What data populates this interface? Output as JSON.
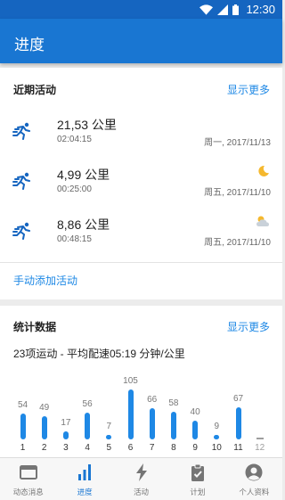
{
  "status_bar": {
    "time": "12:30"
  },
  "app_bar": {
    "title": "进度"
  },
  "recent": {
    "title": "近期活动",
    "more": "显示更多",
    "items": [
      {
        "distance": "21,53 公里",
        "duration": "02:04:15",
        "date": "周一, 2017/11/13",
        "weather": ""
      },
      {
        "distance": "4,99 公里",
        "duration": "00:25:00",
        "date": "周五, 2017/11/10",
        "weather": "moon-icon"
      },
      {
        "distance": "8,86 公里",
        "duration": "00:48:15",
        "date": "周五, 2017/11/10",
        "weather": "cloud-icon"
      }
    ],
    "manual_add": "手动添加活动"
  },
  "stats": {
    "title": "统计数据",
    "more": "显示更多",
    "summary": "23项运动 - 平均配速05:19 分钟/公里"
  },
  "chart_data": {
    "type": "bar",
    "title": "",
    "xlabel": "",
    "ylabel": "",
    "categories": [
      "1",
      "2",
      "3",
      "4",
      "5",
      "6",
      "7",
      "8",
      "9",
      "10",
      "11",
      "12"
    ],
    "values": [
      54,
      49,
      17,
      56,
      7,
      105,
      66,
      58,
      40,
      9,
      67,
      0
    ],
    "value_labels": [
      "54",
      "49",
      "17",
      "56",
      "7",
      "105",
      "66",
      "58",
      "40",
      "9",
      "67",
      ""
    ],
    "ylim": [
      0,
      105
    ],
    "bar_color": "#1e88e5",
    "dim_color": "#9e9e9e",
    "grid": false
  },
  "nav": {
    "items": [
      {
        "label": "动态消息",
        "icon": "feed-icon",
        "active": false
      },
      {
        "label": "进度",
        "icon": "bar-chart-icon",
        "active": true
      },
      {
        "label": "活动",
        "icon": "lightning-icon",
        "active": false
      },
      {
        "label": "计划",
        "icon": "clipboard-icon",
        "active": false
      },
      {
        "label": "个人资料",
        "icon": "profile-icon",
        "active": false
      }
    ]
  },
  "colors": {
    "primary": "#1976d2",
    "status_bar": "#1565c0",
    "accent": "#1e88e5"
  }
}
